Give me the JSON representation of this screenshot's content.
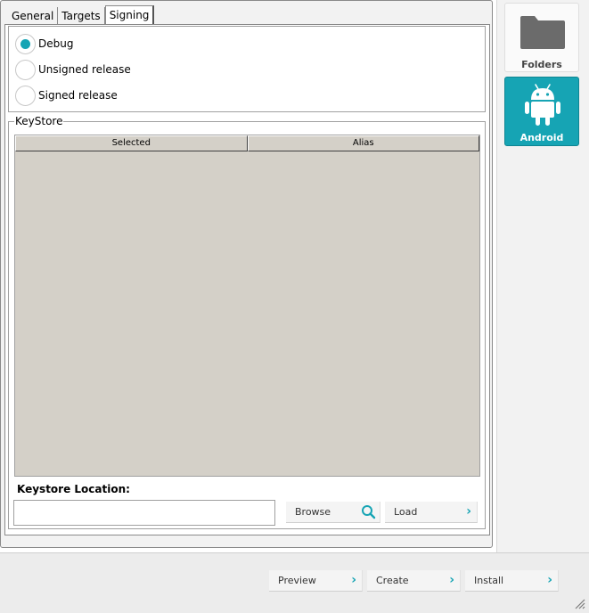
{
  "tabs": [
    {
      "label": "General",
      "active": false
    },
    {
      "label": "Targets",
      "active": false
    },
    {
      "label": "Signing",
      "active": true
    }
  ],
  "signing": {
    "options": [
      {
        "label": "Debug",
        "checked": true
      },
      {
        "label": "Unsigned release",
        "checked": false
      },
      {
        "label": "Signed release",
        "checked": false
      }
    ]
  },
  "keystore": {
    "legend": "KeyStore",
    "columns": [
      "Selected",
      "Alias"
    ],
    "rows": [],
    "location_label": "Keystore Location:",
    "location_value": "",
    "browse_label": "Browse",
    "load_label": "Load"
  },
  "sidebar": {
    "folders_label": "Folders",
    "android_label": "Android"
  },
  "footer": {
    "preview_label": "Preview",
    "create_label": "Create",
    "install_label": "Install"
  },
  "colors": {
    "accent": "#16a4b4",
    "table_bg": "#d4d0c8"
  },
  "icons": [
    "search-icon",
    "chevron-right-icon",
    "folder-icon",
    "android-icon",
    "resize-grip-icon"
  ]
}
